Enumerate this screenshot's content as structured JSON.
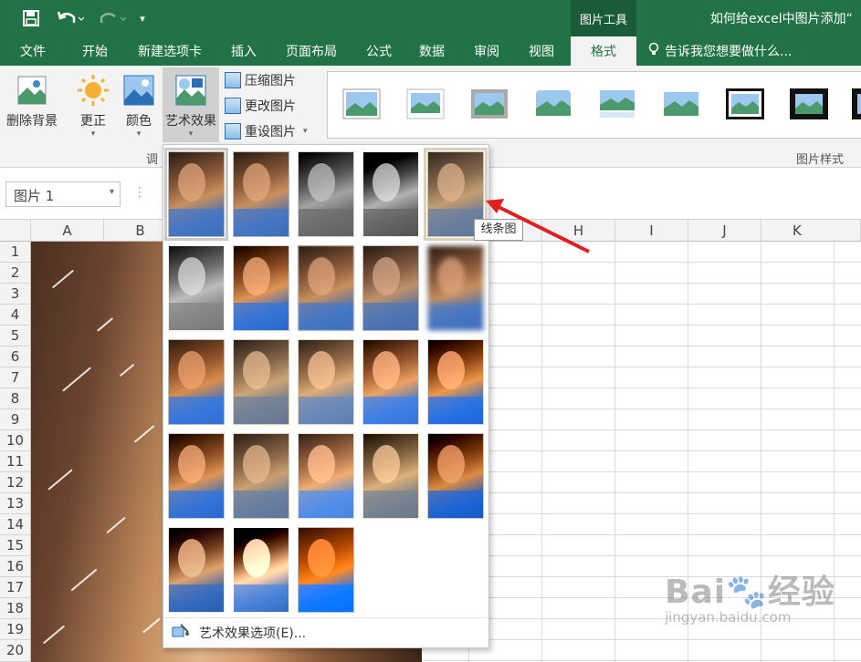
{
  "titlebar": {
    "context_tool": "图片工具",
    "doc_title": "如何给excel中图片添加“"
  },
  "tabs": [
    "文件",
    "开始",
    "新建选项卡",
    "插入",
    "页面布局",
    "公式",
    "数据",
    "审阅",
    "视图",
    "格式"
  ],
  "tell_me": "告诉我您想要做什么...",
  "ribbon": {
    "remove_bg": "删除背景",
    "corrections": "更正",
    "color": "颜色",
    "artistic": "艺术效果",
    "compress": "压缩图片",
    "change": "更改图片",
    "reset": "重设图片",
    "group_adjust": "调",
    "group_styles": "图片样式"
  },
  "namebox": "图片 1",
  "columns": [
    "A",
    "B",
    "H",
    "I",
    "J",
    "K"
  ],
  "rows": [
    "1",
    "2",
    "3",
    "4",
    "5",
    "6",
    "7",
    "8",
    "9",
    "10",
    "11",
    "12",
    "13",
    "14",
    "15",
    "16",
    "17",
    "18",
    "19",
    "20"
  ],
  "dropdown": {
    "tooltip": "线条图",
    "footer": "艺术效果选项(E)..."
  },
  "watermark": {
    "brand": "Bai",
    "brand2": "经验",
    "url": "jingyan.baidu.com"
  }
}
